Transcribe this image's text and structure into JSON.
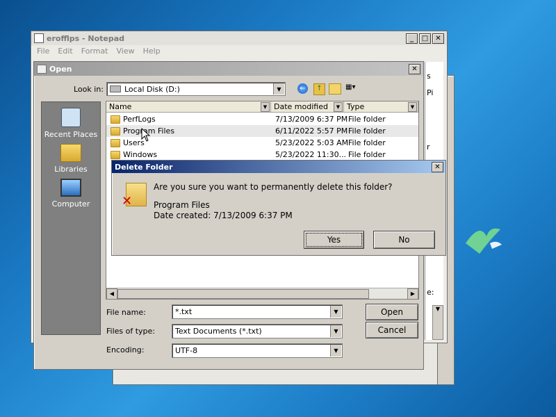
{
  "colors": {
    "desktop": "#1a78c2",
    "dialog_title": "#0a246a",
    "panel": "#d4d0c8"
  },
  "notepad": {
    "title": "erofflps - Notepad",
    "menu": [
      "File",
      "Edit",
      "Format",
      "View",
      "Help"
    ],
    "side_text": [
      "s",
      "Pi",
      "r",
      " ",
      "e:"
    ]
  },
  "open_dialog": {
    "title": "Open",
    "look_in_label": "Look in:",
    "look_in_value": "Local Disk (D:)",
    "places": [
      {
        "label": "Recent Places",
        "icon": "recent-places-icon"
      },
      {
        "label": "Libraries",
        "icon": "libraries-icon"
      },
      {
        "label": "Computer",
        "icon": "computer-icon"
      }
    ],
    "columns": [
      "Name",
      "Date modified",
      "Type"
    ],
    "files": [
      {
        "name": "PerfLogs",
        "date": "7/13/2009 6:37 PM",
        "type": "File folder"
      },
      {
        "name": "Program Files",
        "date": "6/11/2022 5:57 PM",
        "type": "File folder"
      },
      {
        "name": "Users",
        "date": "5/23/2022 5:03 AM",
        "type": "File folder"
      },
      {
        "name": "Windows",
        "date": "5/23/2022 11:30...",
        "type": "File folder"
      }
    ],
    "file_name_label": "File name:",
    "file_name_value": "*.txt",
    "file_type_label": "Files of type:",
    "file_type_value": "Text Documents (*.txt)",
    "encoding_label": "Encoding:",
    "encoding_value": "UTF-8",
    "open_label": "Open",
    "cancel_label": "Cancel"
  },
  "delete_dialog": {
    "title": "Delete Folder",
    "question": "Are you sure you want to permanently delete this folder?",
    "item_name": "Program Files",
    "item_date": "Date created: 7/13/2009 6:37 PM",
    "yes_label": "Yes",
    "no_label": "No"
  },
  "controls": {
    "minimize": "_",
    "maximize": "□",
    "close": "✕"
  }
}
